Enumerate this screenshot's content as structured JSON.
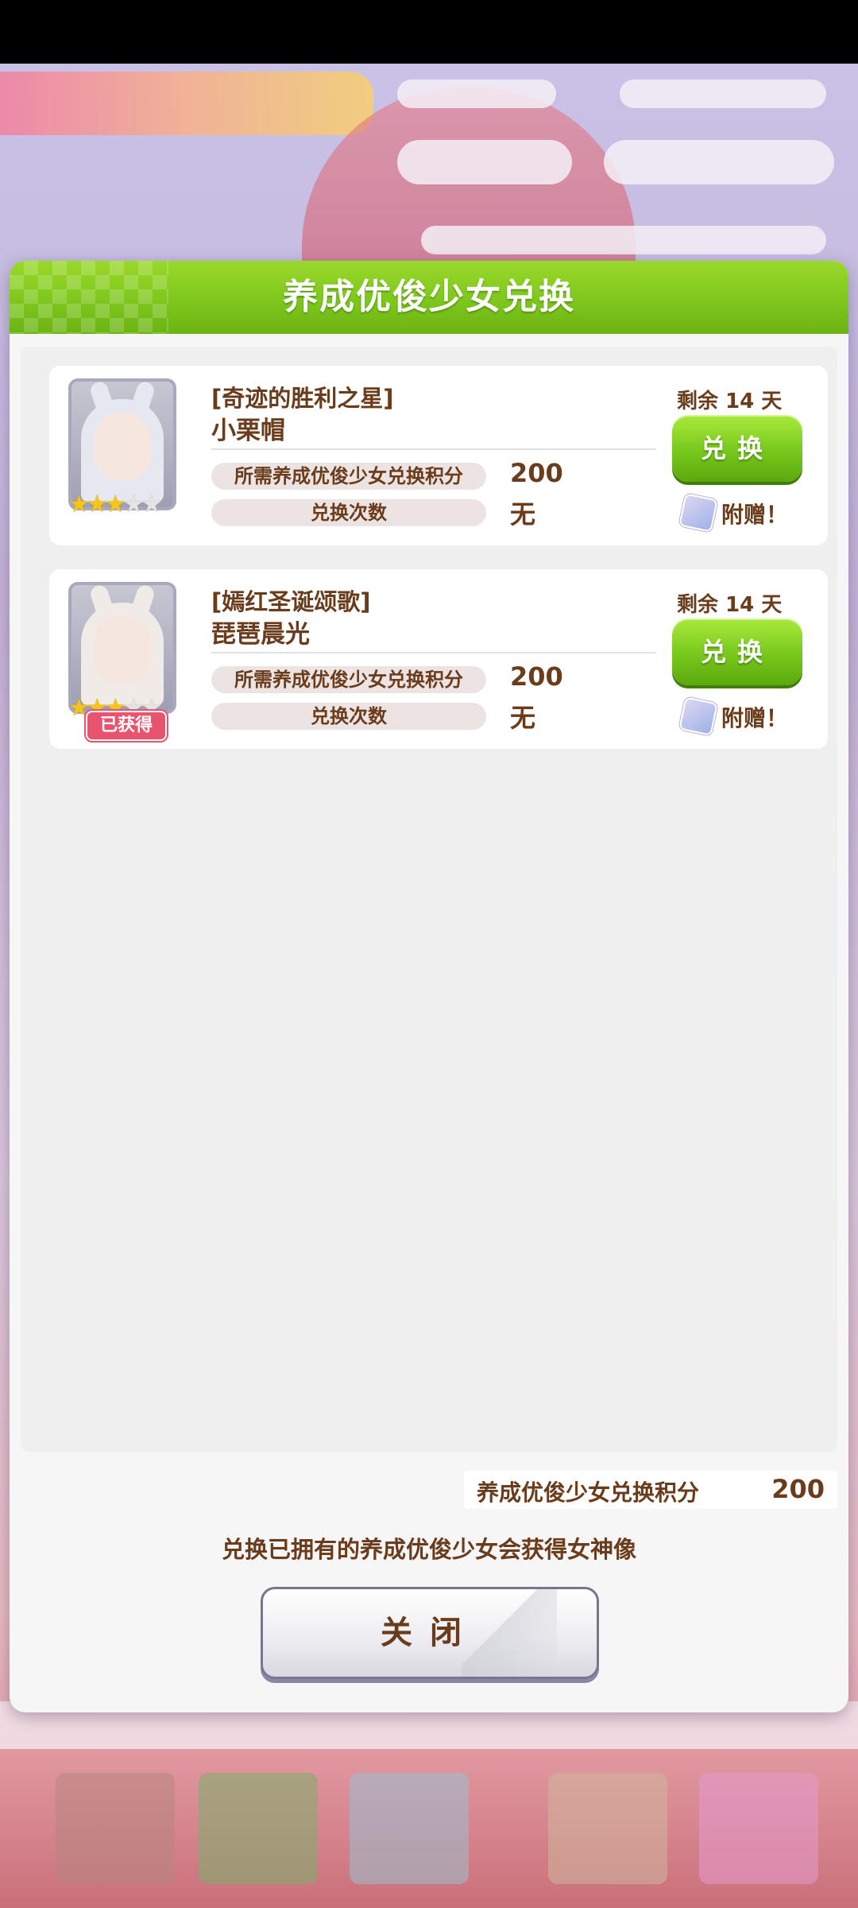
{
  "dialog": {
    "title": "养成优俊少女兑换",
    "items": [
      {
        "subtitle": "[奇迹的胜利之星]",
        "name": "小栗帽",
        "points_label": "所需养成优俊少女兑换积分",
        "points_value": "200",
        "count_label": "兑换次数",
        "count_value": "无",
        "remaining": "剩余 14 天",
        "exchange_label": "兑换",
        "bonus_label": "附赠！",
        "stars_filled": 3,
        "stars_total": 5,
        "owned": false
      },
      {
        "subtitle": "[嫣红圣诞颂歌]",
        "name": "琵琶晨光",
        "points_label": "所需养成优俊少女兑换积分",
        "points_value": "200",
        "count_label": "兑换次数",
        "count_value": "无",
        "remaining": "剩余 14 天",
        "exchange_label": "兑换",
        "bonus_label": "附赠！",
        "owned_label": "已获得",
        "stars_filled": 3,
        "stars_total": 5,
        "owned": true
      }
    ],
    "points_label": "养成优俊少女兑换积分",
    "points_value": "200",
    "note": "兑换已拥有的养成优俊少女会获得女神像",
    "close_label": "关闭"
  },
  "colors": {
    "header_green": "#7bc51c",
    "text_brown": "#6a3c1c",
    "owned_badge": "#e8546e"
  },
  "icons": {
    "star": "star-icon",
    "bonus": "bonus-gift-icon"
  }
}
